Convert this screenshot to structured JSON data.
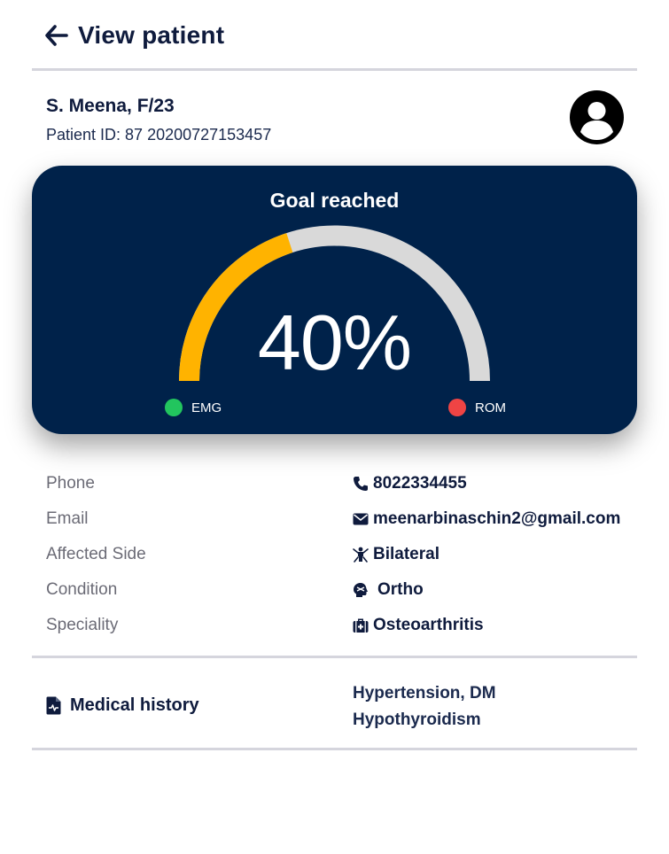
{
  "header": {
    "title": "View patient",
    "back_icon": "arrow-left-icon"
  },
  "patient": {
    "name": "S. Meena, F/23",
    "id_line": "Patient ID: 87 20200727153457",
    "avatar_icon": "user-circle-icon"
  },
  "goal": {
    "title": "Goal reached",
    "value_text": "40%",
    "progress": 0.4,
    "colors": {
      "card_bg": "#00224a",
      "filled": "#ffb300",
      "track": "#d9d9d9"
    },
    "legend": [
      {
        "label": "EMG",
        "color": "#22c55e"
      },
      {
        "label": "ROM",
        "color": "#ef4444"
      }
    ]
  },
  "details": [
    {
      "label": "Phone",
      "value": "8022334455",
      "icon": "phone-icon"
    },
    {
      "label": "Email",
      "value": "meenarbinaschin2@gmail.com",
      "icon": "envelope-icon"
    },
    {
      "label": "Affected Side",
      "value": "Bilateral",
      "icon": "person-bilateral-icon"
    },
    {
      "label": "Condition",
      "value": "Ortho",
      "icon": "head-injury-icon"
    },
    {
      "label": "Speciality",
      "value": "Osteoarthritis",
      "icon": "medkit-icon"
    }
  ],
  "medical_history": {
    "label": "Medical history",
    "icon": "file-medical-icon",
    "lines": [
      "Hypertension, DM",
      "Hypothyroidism"
    ]
  }
}
